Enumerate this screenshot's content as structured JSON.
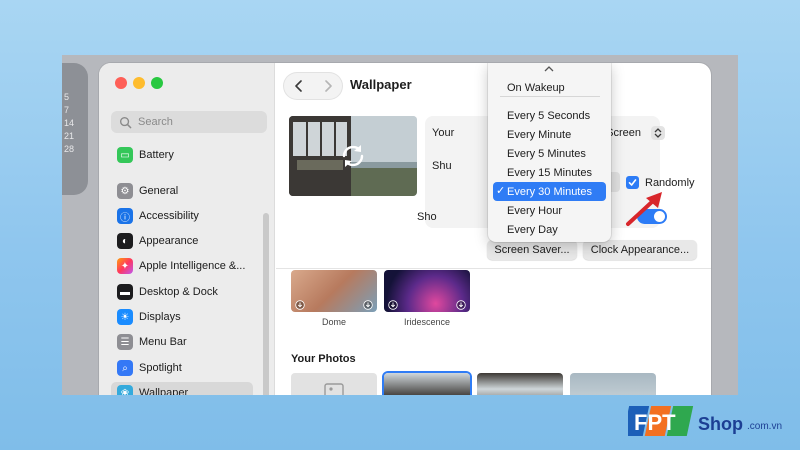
{
  "calendar": {
    "days": [
      "5",
      "7",
      "14",
      "21",
      "28"
    ]
  },
  "sidebar": {
    "search_placeholder": "Search",
    "items": [
      {
        "label": "Battery",
        "icon": "battery-icon",
        "color": "#34c759"
      },
      {
        "label": "General",
        "icon": "gear-icon",
        "color": "#8e8e93"
      },
      {
        "label": "Accessibility",
        "icon": "accessibility-icon",
        "color": "#1a73e8"
      },
      {
        "label": "Appearance",
        "icon": "appearance-icon",
        "color": "#1c1c1e"
      },
      {
        "label": "Apple Intelligence &...",
        "icon": "apple-intelligence-icon",
        "color": "#ff7a59"
      },
      {
        "label": "Desktop & Dock",
        "icon": "dock-icon",
        "color": "#1c1c1e"
      },
      {
        "label": "Displays",
        "icon": "display-icon",
        "color": "#1a8cff"
      },
      {
        "label": "Menu Bar",
        "icon": "menu-bar-icon",
        "color": "#8e8e93"
      },
      {
        "label": "Spotlight",
        "icon": "spotlight-icon",
        "color": "#3478f6"
      },
      {
        "label": "Wallpaper",
        "icon": "wallpaper-icon",
        "color": "#34aadc"
      }
    ]
  },
  "header": {
    "title": "Wallpaper"
  },
  "panel": {
    "your_label": "Your",
    "fill_value": "Fill Screen",
    "shuffle_label": "Shu",
    "randomly_label": "Randomly",
    "randomly_checked": true,
    "show_label": "Sho",
    "toggle_on": true
  },
  "buttons": {
    "screen_saver": "Screen Saver...",
    "clock_appearance": "Clock Appearance..."
  },
  "wallpapers": [
    {
      "label": "Dome"
    },
    {
      "label": "Iridescence"
    }
  ],
  "your_photos": {
    "title": "Your Photos"
  },
  "menu": {
    "items": [
      {
        "label": "On Wakeup",
        "selected": false
      },
      {
        "label": "Every 5 Seconds",
        "selected": false
      },
      {
        "label": "Every Minute",
        "selected": false
      },
      {
        "label": "Every 5 Minutes",
        "selected": false
      },
      {
        "label": "Every 15 Minutes",
        "selected": false
      },
      {
        "label": "Every 30 Minutes",
        "selected": true
      },
      {
        "label": "Every Hour",
        "selected": false
      },
      {
        "label": "Every Day",
        "selected": false
      }
    ],
    "check_glyph": "✓"
  },
  "brand": {
    "name": "FPT",
    "shop": "Shop",
    "domain": ".com.vn"
  },
  "colors": {
    "accent": "#2f7cf5",
    "annotation_arrow": "#d8262b"
  }
}
